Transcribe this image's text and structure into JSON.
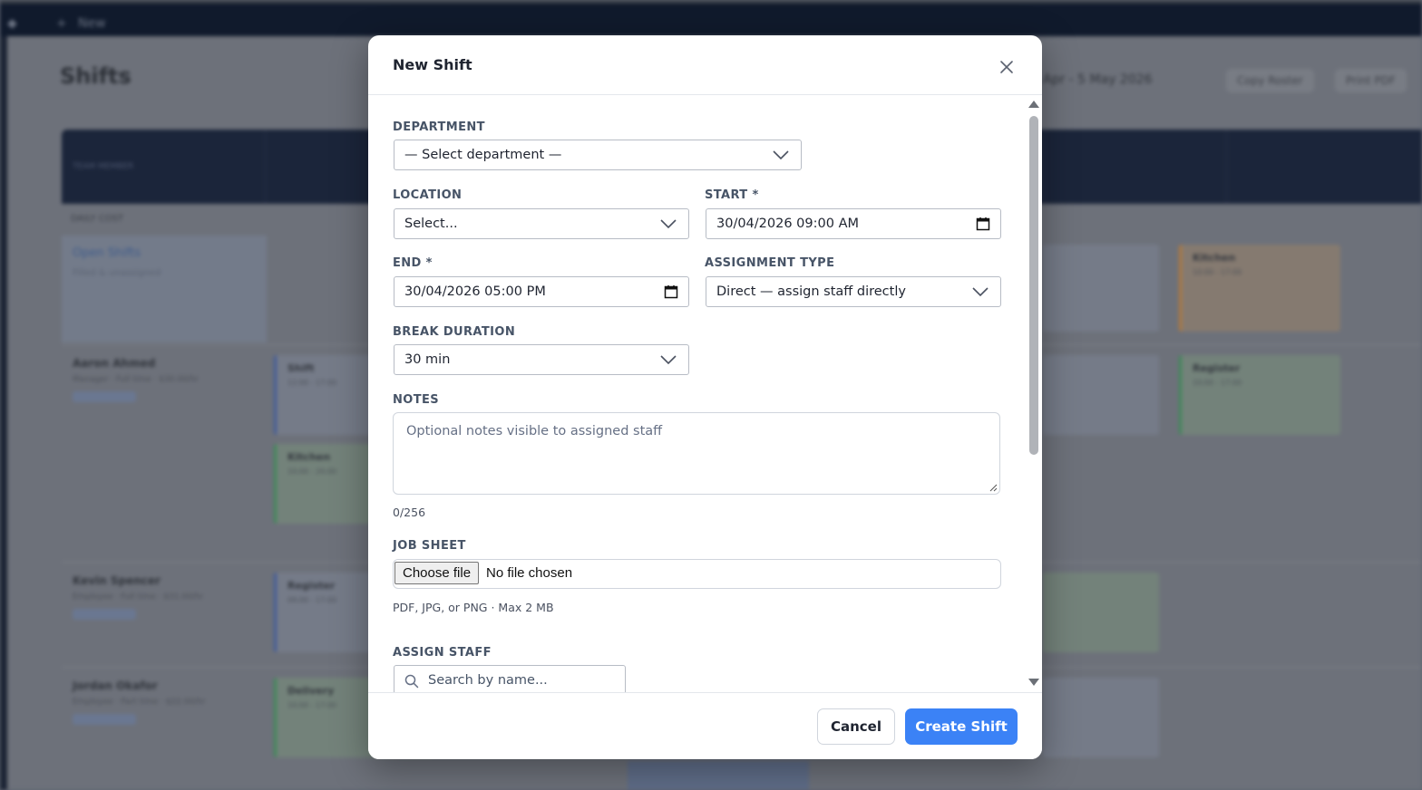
{
  "background": {
    "topbar_item": "New",
    "page_title": "Shifts",
    "date_range": "Apr - 5 May 2026",
    "buttons": [
      "Copy Roster",
      "Print PDF"
    ],
    "column_header": "TEAM MEMBER",
    "daily_cost": "DAILY COST",
    "open_shifts": {
      "title": "Open Shifts",
      "subtitle": "Filled & unassigned"
    },
    "people": [
      {
        "name": "Aaron Ahmed",
        "role": "Manager · Full time · $30.00/hr"
      },
      {
        "name": "Kevin Spencer",
        "role": "Employee · Full time · $31.00/hr"
      },
      {
        "name": "Jordan Okafor",
        "role": "Employee · Part time · $22.00/hr"
      }
    ],
    "cards": [
      {
        "name": "Shift",
        "time": "12:00 - 17:00"
      },
      {
        "name": "Kitchen",
        "time": "10:00 - 20:00"
      },
      {
        "name": "Register",
        "time": "09:00 - 17:00"
      },
      {
        "name": "Delivery",
        "time": "10:00 - 17:00"
      },
      {
        "name": "Kitchen",
        "time": "10:00 - 17:00"
      },
      {
        "name": "Register",
        "time": "10:00 - 17:00"
      }
    ]
  },
  "modal": {
    "title": "New Shift",
    "department": {
      "label": "DEPARTMENT",
      "value": "— Select department —"
    },
    "location": {
      "label": "LOCATION",
      "value": "Select..."
    },
    "start": {
      "label": "START *",
      "value": "30/04/2026 09:00 AM"
    },
    "end": {
      "label": "END *",
      "value": "30/04/2026 05:00 PM"
    },
    "assignment_type": {
      "label": "ASSIGNMENT TYPE",
      "value": "Direct — assign staff directly"
    },
    "break_duration": {
      "label": "BREAK DURATION",
      "value": "30 min"
    },
    "notes": {
      "label": "NOTES",
      "placeholder": "Optional notes visible to assigned staff",
      "counter": "0/256"
    },
    "job_sheet": {
      "label": "JOB SHEET",
      "button": "Choose file",
      "status": "No file chosen",
      "hint": "PDF, JPG, or PNG · Max 2 MB"
    },
    "assign_staff": {
      "label": "ASSIGN STAFF",
      "placeholder": "Search by name..."
    },
    "cancel_label": "Cancel",
    "create_label": "Create Shift"
  }
}
